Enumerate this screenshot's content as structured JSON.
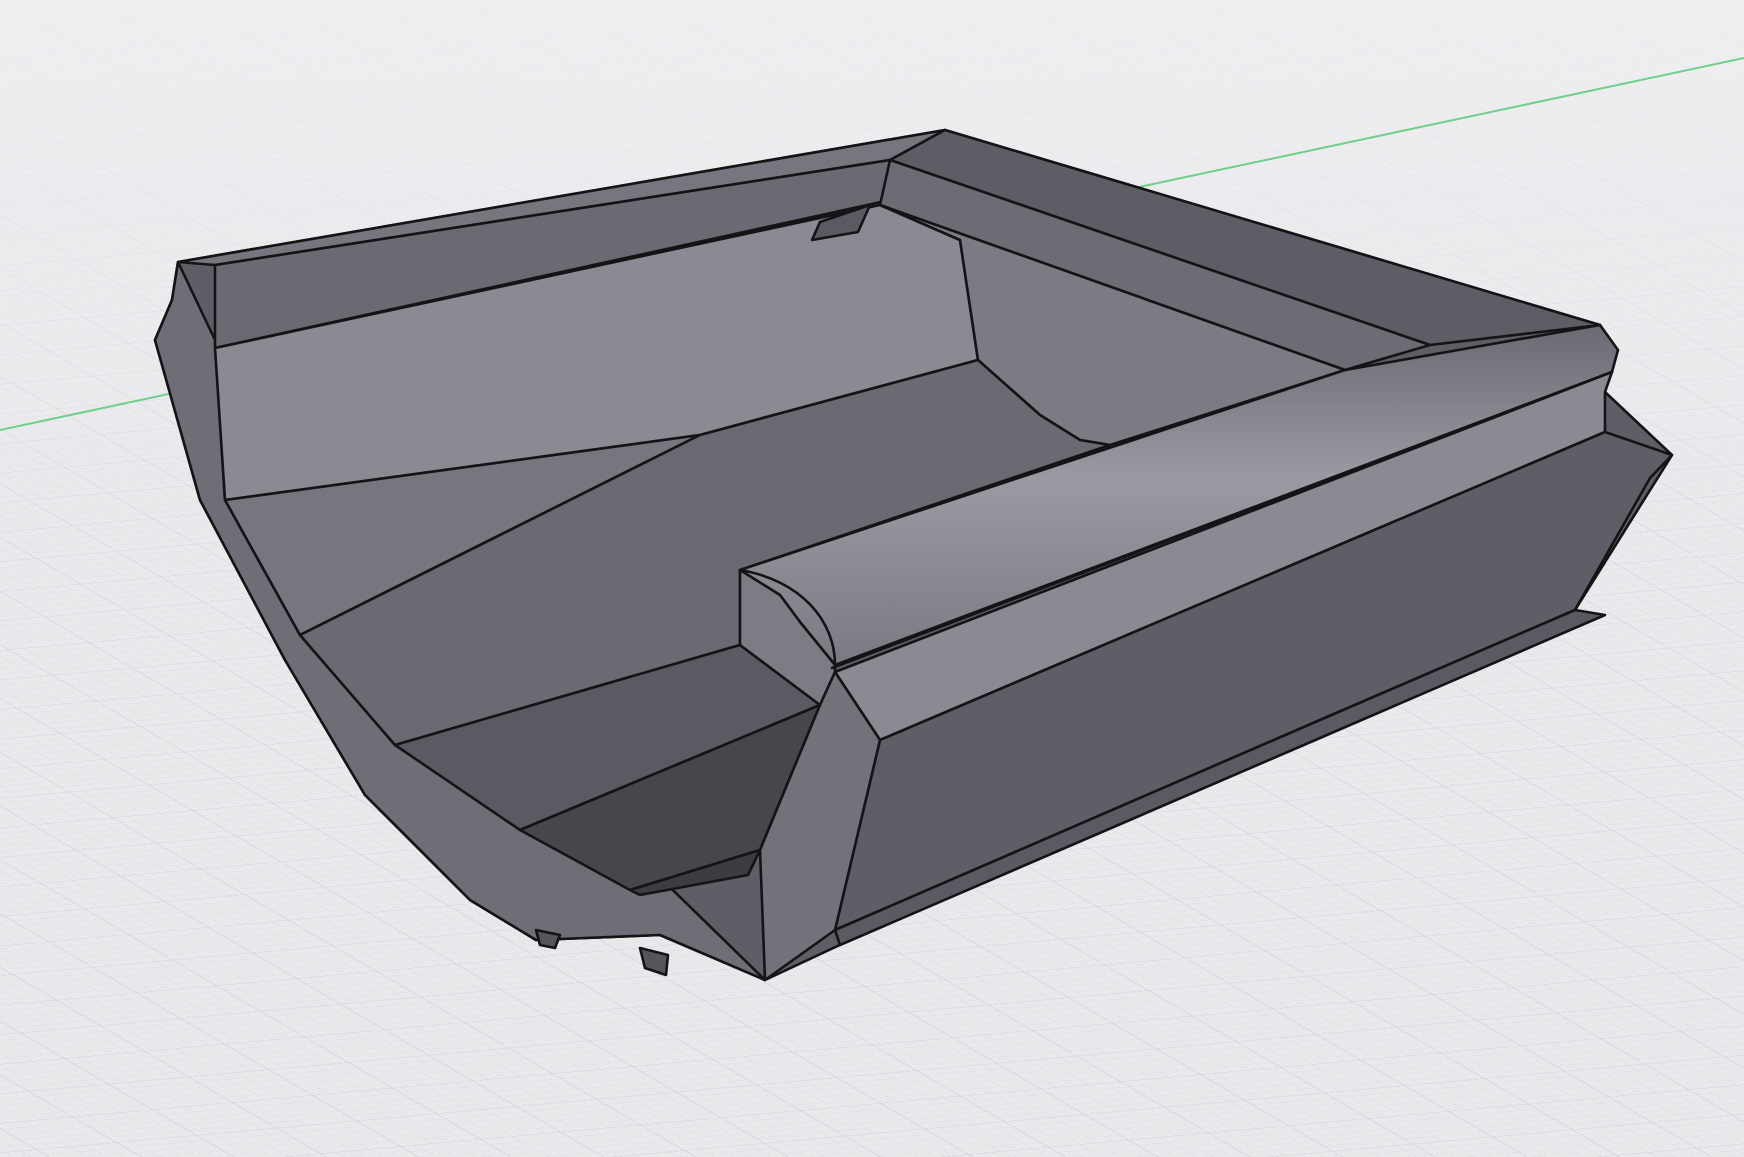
{
  "viewport": {
    "background_color": "#e9e9ec",
    "grid_minor_color": "#d6d6db",
    "grid_major_color": "#c4c4ca",
    "axis_line_color": "#6fcf8c"
  },
  "model": {
    "edge_color": "#141416",
    "face_colors": {
      "light": "#8b8b93",
      "mid": "#76767e",
      "dark": "#5e5e66",
      "deep": "#46464c"
    }
  }
}
